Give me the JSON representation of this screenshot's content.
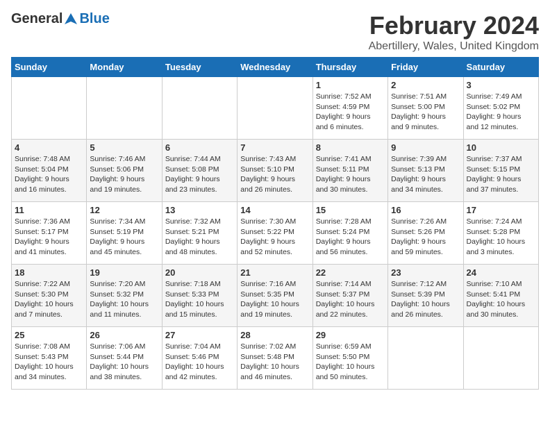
{
  "header": {
    "logo_general": "General",
    "logo_blue": "Blue",
    "month_title": "February 2024",
    "location": "Abertillery, Wales, United Kingdom"
  },
  "weekdays": [
    "Sunday",
    "Monday",
    "Tuesday",
    "Wednesday",
    "Thursday",
    "Friday",
    "Saturday"
  ],
  "weeks": [
    [
      {
        "day": "",
        "info": ""
      },
      {
        "day": "",
        "info": ""
      },
      {
        "day": "",
        "info": ""
      },
      {
        "day": "",
        "info": ""
      },
      {
        "day": "1",
        "info": "Sunrise: 7:52 AM\nSunset: 4:59 PM\nDaylight: 9 hours\nand 6 minutes."
      },
      {
        "day": "2",
        "info": "Sunrise: 7:51 AM\nSunset: 5:00 PM\nDaylight: 9 hours\nand 9 minutes."
      },
      {
        "day": "3",
        "info": "Sunrise: 7:49 AM\nSunset: 5:02 PM\nDaylight: 9 hours\nand 12 minutes."
      }
    ],
    [
      {
        "day": "4",
        "info": "Sunrise: 7:48 AM\nSunset: 5:04 PM\nDaylight: 9 hours\nand 16 minutes."
      },
      {
        "day": "5",
        "info": "Sunrise: 7:46 AM\nSunset: 5:06 PM\nDaylight: 9 hours\nand 19 minutes."
      },
      {
        "day": "6",
        "info": "Sunrise: 7:44 AM\nSunset: 5:08 PM\nDaylight: 9 hours\nand 23 minutes."
      },
      {
        "day": "7",
        "info": "Sunrise: 7:43 AM\nSunset: 5:10 PM\nDaylight: 9 hours\nand 26 minutes."
      },
      {
        "day": "8",
        "info": "Sunrise: 7:41 AM\nSunset: 5:11 PM\nDaylight: 9 hours\nand 30 minutes."
      },
      {
        "day": "9",
        "info": "Sunrise: 7:39 AM\nSunset: 5:13 PM\nDaylight: 9 hours\nand 34 minutes."
      },
      {
        "day": "10",
        "info": "Sunrise: 7:37 AM\nSunset: 5:15 PM\nDaylight: 9 hours\nand 37 minutes."
      }
    ],
    [
      {
        "day": "11",
        "info": "Sunrise: 7:36 AM\nSunset: 5:17 PM\nDaylight: 9 hours\nand 41 minutes."
      },
      {
        "day": "12",
        "info": "Sunrise: 7:34 AM\nSunset: 5:19 PM\nDaylight: 9 hours\nand 45 minutes."
      },
      {
        "day": "13",
        "info": "Sunrise: 7:32 AM\nSunset: 5:21 PM\nDaylight: 9 hours\nand 48 minutes."
      },
      {
        "day": "14",
        "info": "Sunrise: 7:30 AM\nSunset: 5:22 PM\nDaylight: 9 hours\nand 52 minutes."
      },
      {
        "day": "15",
        "info": "Sunrise: 7:28 AM\nSunset: 5:24 PM\nDaylight: 9 hours\nand 56 minutes."
      },
      {
        "day": "16",
        "info": "Sunrise: 7:26 AM\nSunset: 5:26 PM\nDaylight: 9 hours\nand 59 minutes."
      },
      {
        "day": "17",
        "info": "Sunrise: 7:24 AM\nSunset: 5:28 PM\nDaylight: 10 hours\nand 3 minutes."
      }
    ],
    [
      {
        "day": "18",
        "info": "Sunrise: 7:22 AM\nSunset: 5:30 PM\nDaylight: 10 hours\nand 7 minutes."
      },
      {
        "day": "19",
        "info": "Sunrise: 7:20 AM\nSunset: 5:32 PM\nDaylight: 10 hours\nand 11 minutes."
      },
      {
        "day": "20",
        "info": "Sunrise: 7:18 AM\nSunset: 5:33 PM\nDaylight: 10 hours\nand 15 minutes."
      },
      {
        "day": "21",
        "info": "Sunrise: 7:16 AM\nSunset: 5:35 PM\nDaylight: 10 hours\nand 19 minutes."
      },
      {
        "day": "22",
        "info": "Sunrise: 7:14 AM\nSunset: 5:37 PM\nDaylight: 10 hours\nand 22 minutes."
      },
      {
        "day": "23",
        "info": "Sunrise: 7:12 AM\nSunset: 5:39 PM\nDaylight: 10 hours\nand 26 minutes."
      },
      {
        "day": "24",
        "info": "Sunrise: 7:10 AM\nSunset: 5:41 PM\nDaylight: 10 hours\nand 30 minutes."
      }
    ],
    [
      {
        "day": "25",
        "info": "Sunrise: 7:08 AM\nSunset: 5:43 PM\nDaylight: 10 hours\nand 34 minutes."
      },
      {
        "day": "26",
        "info": "Sunrise: 7:06 AM\nSunset: 5:44 PM\nDaylight: 10 hours\nand 38 minutes."
      },
      {
        "day": "27",
        "info": "Sunrise: 7:04 AM\nSunset: 5:46 PM\nDaylight: 10 hours\nand 42 minutes."
      },
      {
        "day": "28",
        "info": "Sunrise: 7:02 AM\nSunset: 5:48 PM\nDaylight: 10 hours\nand 46 minutes."
      },
      {
        "day": "29",
        "info": "Sunrise: 6:59 AM\nSunset: 5:50 PM\nDaylight: 10 hours\nand 50 minutes."
      },
      {
        "day": "",
        "info": ""
      },
      {
        "day": "",
        "info": ""
      }
    ]
  ]
}
